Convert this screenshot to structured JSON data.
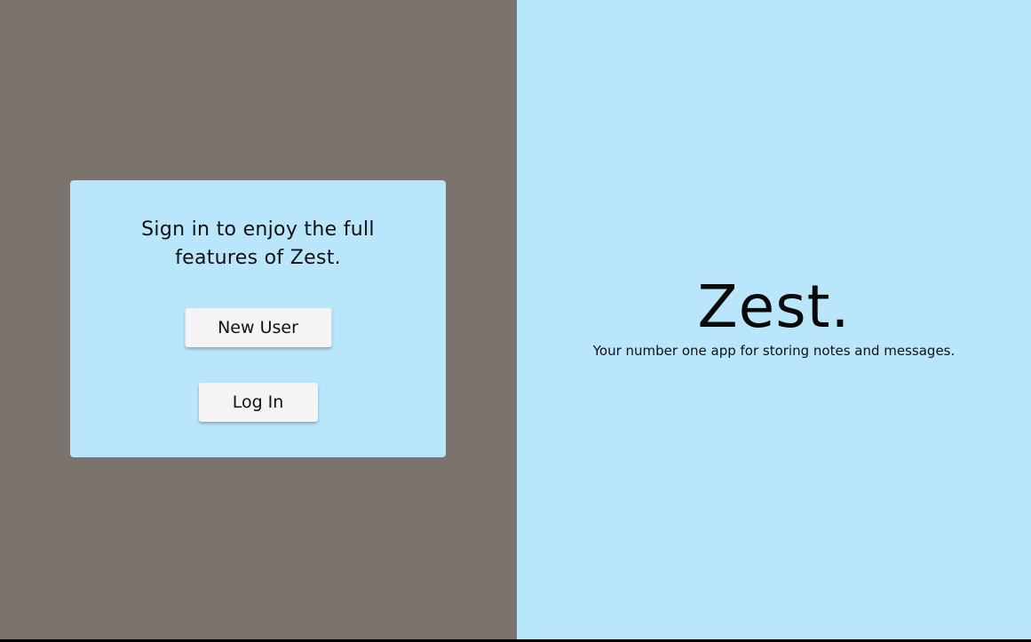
{
  "colors": {
    "left_background": "#7b736e",
    "accent_light_blue": "#bae6fb",
    "button_background": "#f4f4f4",
    "text": "#111111"
  },
  "signin": {
    "message": "Sign in to enjoy the full features of Zest.",
    "new_user_label": "New User",
    "login_label": "Log In"
  },
  "brand": {
    "title": "Zest.",
    "tagline": "Your number one app for storing notes and messages."
  }
}
